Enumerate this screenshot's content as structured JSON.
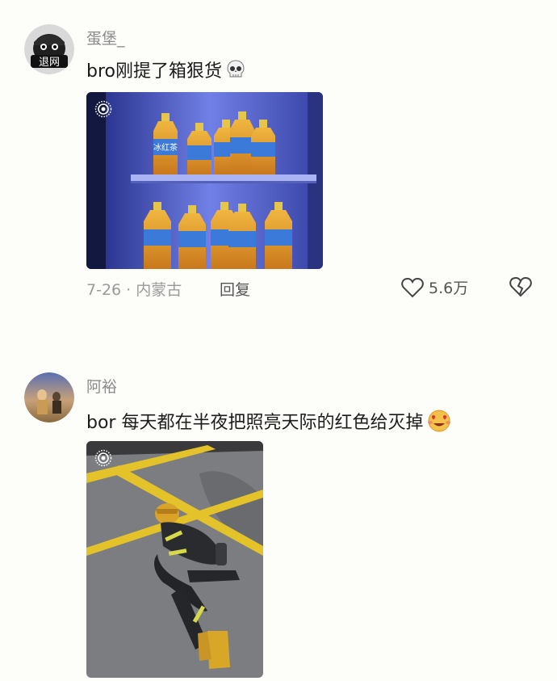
{
  "comments": [
    {
      "username": "蛋堡_",
      "text": "bro刚提了箱狠货",
      "emoji": "skull-emoji",
      "avatar_text": "退网",
      "time_location": "7-26 · 内蒙古",
      "reply_label": "回复",
      "like_count": "5.6万"
    },
    {
      "username": "阿裕",
      "text": "bor 每天都在半夜把照亮天际的红色给灭掉",
      "emoji": "heart-eyes-emoji",
      "bottle_label": "冰红茶"
    }
  ],
  "colors": {
    "background": "#fdfdfa",
    "username": "#8a8a8a",
    "meta": "#9a9a9a",
    "fridge_light": "#6a7ae0",
    "bottle": "#e9a733",
    "pavement": "#7b7d80",
    "parking_line": "#e3c22a"
  }
}
